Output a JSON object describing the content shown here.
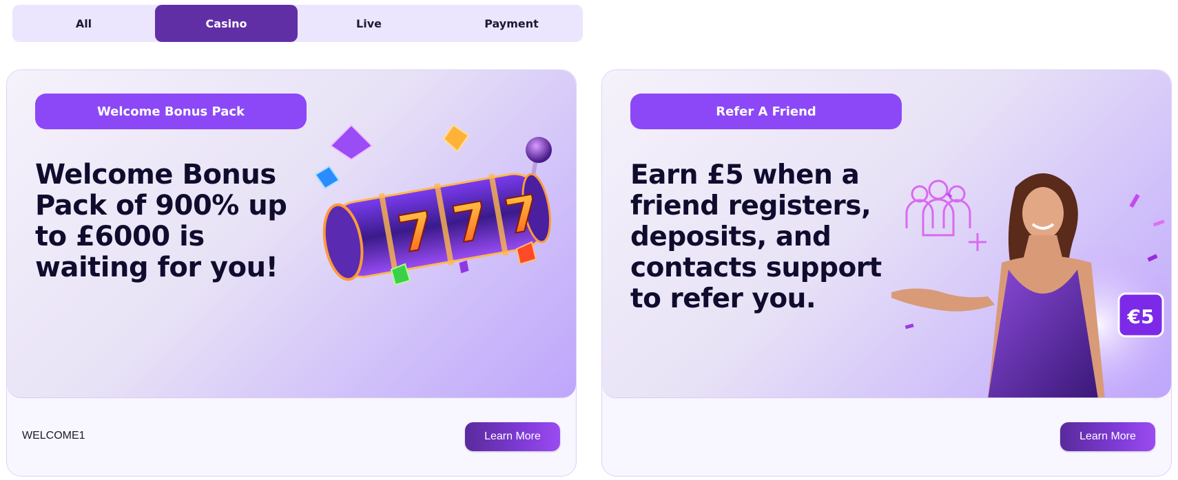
{
  "tabs": [
    {
      "label": "All",
      "active": false
    },
    {
      "label": "Casino",
      "active": true
    },
    {
      "label": "Live",
      "active": false
    },
    {
      "label": "Payment",
      "active": false
    }
  ],
  "cards": [
    {
      "badge": "Welcome Bonus Pack",
      "headline": "Welcome Bonus Pack of 900% up to £6000 is waiting for you!",
      "code": "WELCOME1",
      "button": "Learn More",
      "image": "slot-machine-777-icon"
    },
    {
      "badge": "Refer A Friend",
      "headline": "Earn £5 when a friend registers, deposits, and contacts support to refer you.",
      "code": "",
      "button": "Learn More",
      "image": "woman-referral-icon",
      "amount_badge": "€5"
    }
  ],
  "colors": {
    "tab_bg": "#ebe5fd",
    "tab_active": "#612fa5",
    "pill": "#8c48f7",
    "headline": "#0f0c2e"
  }
}
